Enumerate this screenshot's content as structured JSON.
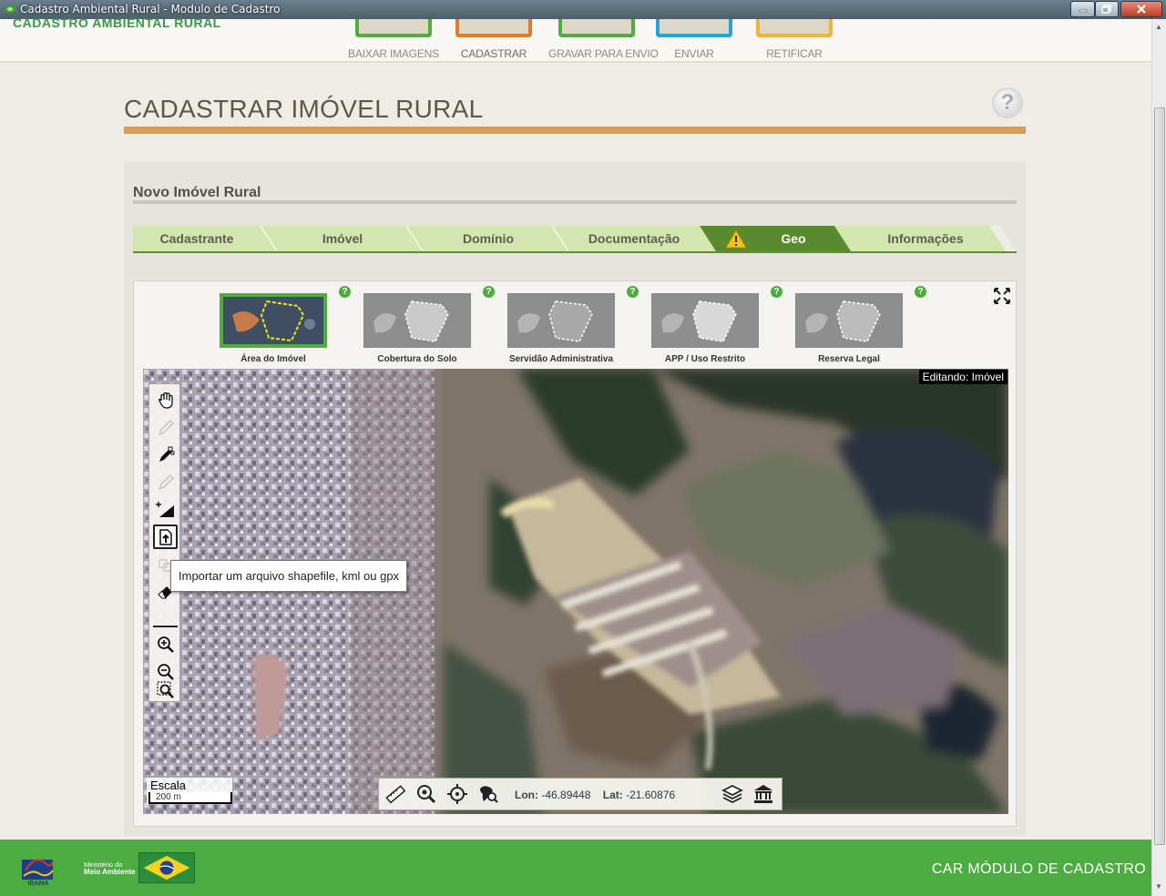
{
  "window": {
    "title": "Cadastro Ambiental Rural - Modulo de Cadastro"
  },
  "header": {
    "brand": "CADASTRO AMBIENTAL RURAL",
    "steps": [
      {
        "label": "BAIXAR IMAGENS",
        "color": "#4fae3c"
      },
      {
        "label": "CADASTRAR",
        "color": "#e07b2a"
      },
      {
        "label": "GRAVAR PARA ENVIO",
        "color": "#4fae3c"
      },
      {
        "label": "ENVIAR",
        "color": "#27a3d8"
      },
      {
        "label": "RETIFICAR",
        "color": "#f0b43a"
      }
    ]
  },
  "page": {
    "title": "CADASTRAR IMÓVEL RURAL",
    "help": "?"
  },
  "panel": {
    "title": "Novo Imóvel Rural",
    "tabs": [
      {
        "label": "Cadastrante"
      },
      {
        "label": "Imóvel"
      },
      {
        "label": "Domínio"
      },
      {
        "label": "Documentação"
      },
      {
        "label": "Geo",
        "active": true,
        "warning": true
      },
      {
        "label": "Informações"
      }
    ]
  },
  "geo": {
    "thumbnails": [
      {
        "label": "Área do Imóvel",
        "active": true
      },
      {
        "label": "Cobertura do Solo"
      },
      {
        "label": "Servidão Administrativa"
      },
      {
        "label": "APP / Uso Restrito"
      },
      {
        "label": "Reserva Legal"
      }
    ],
    "help_badge": "?",
    "map": {
      "editing_label": "Editando: Imóvel",
      "tools": [
        {
          "name": "pan-hand-icon"
        },
        {
          "name": "draw-pencil-icon",
          "disabled": true
        },
        {
          "name": "edit-vertices-icon"
        },
        {
          "name": "cut-icon",
          "disabled": true
        },
        {
          "name": "add-area-icon"
        },
        {
          "name": "import-file-icon",
          "selected": true
        },
        {
          "name": "merge-icon",
          "disabled": true
        },
        {
          "name": "eraser-icon"
        },
        {
          "name": "zoom-in-icon"
        },
        {
          "name": "zoom-out-icon"
        },
        {
          "name": "zoom-extent-icon"
        }
      ],
      "tooltip": "Importar um arquivo shapefile, kml ou gpx",
      "scale_label": "Escala",
      "scale_value": "200 m",
      "coords": {
        "lon_label": "Lon:",
        "lon_value": "-46.89448",
        "lat_label": "Lat:",
        "lat_value": "-21.60876"
      }
    }
  },
  "footer": {
    "ibama": "IBAMA",
    "mma_small": "Ministério do",
    "mma_big": "Meio Ambiente",
    "car_label": "CAR  MÓDULO DE CADASTRO"
  }
}
